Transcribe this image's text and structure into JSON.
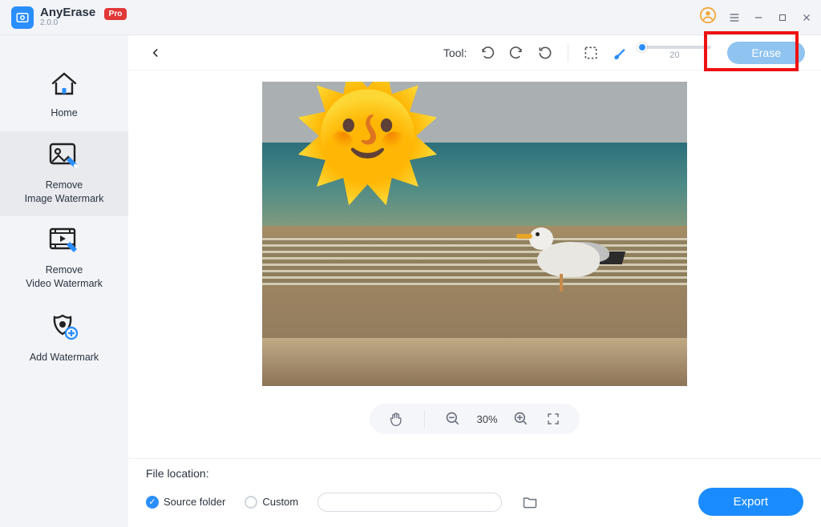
{
  "app": {
    "name": "AnyErase",
    "version": "2.0.0",
    "pro": "Pro"
  },
  "sidebar": {
    "items": [
      {
        "label": "Home"
      },
      {
        "label": "Remove\nImage Watermark"
      },
      {
        "label": "Remove\nVideo Watermark"
      },
      {
        "label": "Add Watermark"
      }
    ],
    "active_index": 1
  },
  "toolbar": {
    "tool_label": "Tool:",
    "slider_value": "20",
    "erase_label": "Erase"
  },
  "zoom": {
    "value": "30%"
  },
  "footer": {
    "file_location_label": "File location:",
    "source_folder_label": "Source folder",
    "custom_label": "Custom",
    "export_label": "Export"
  },
  "icons": {
    "undo": "undo-icon",
    "redo": "redo-icon",
    "reset": "reset-icon",
    "marquee": "marquee-icon",
    "brush": "brush-icon",
    "account": "account-icon",
    "menu": "menu-icon"
  },
  "colors": {
    "accent": "#2b8eff",
    "danger": "#e23838",
    "highlight": "#e11"
  }
}
